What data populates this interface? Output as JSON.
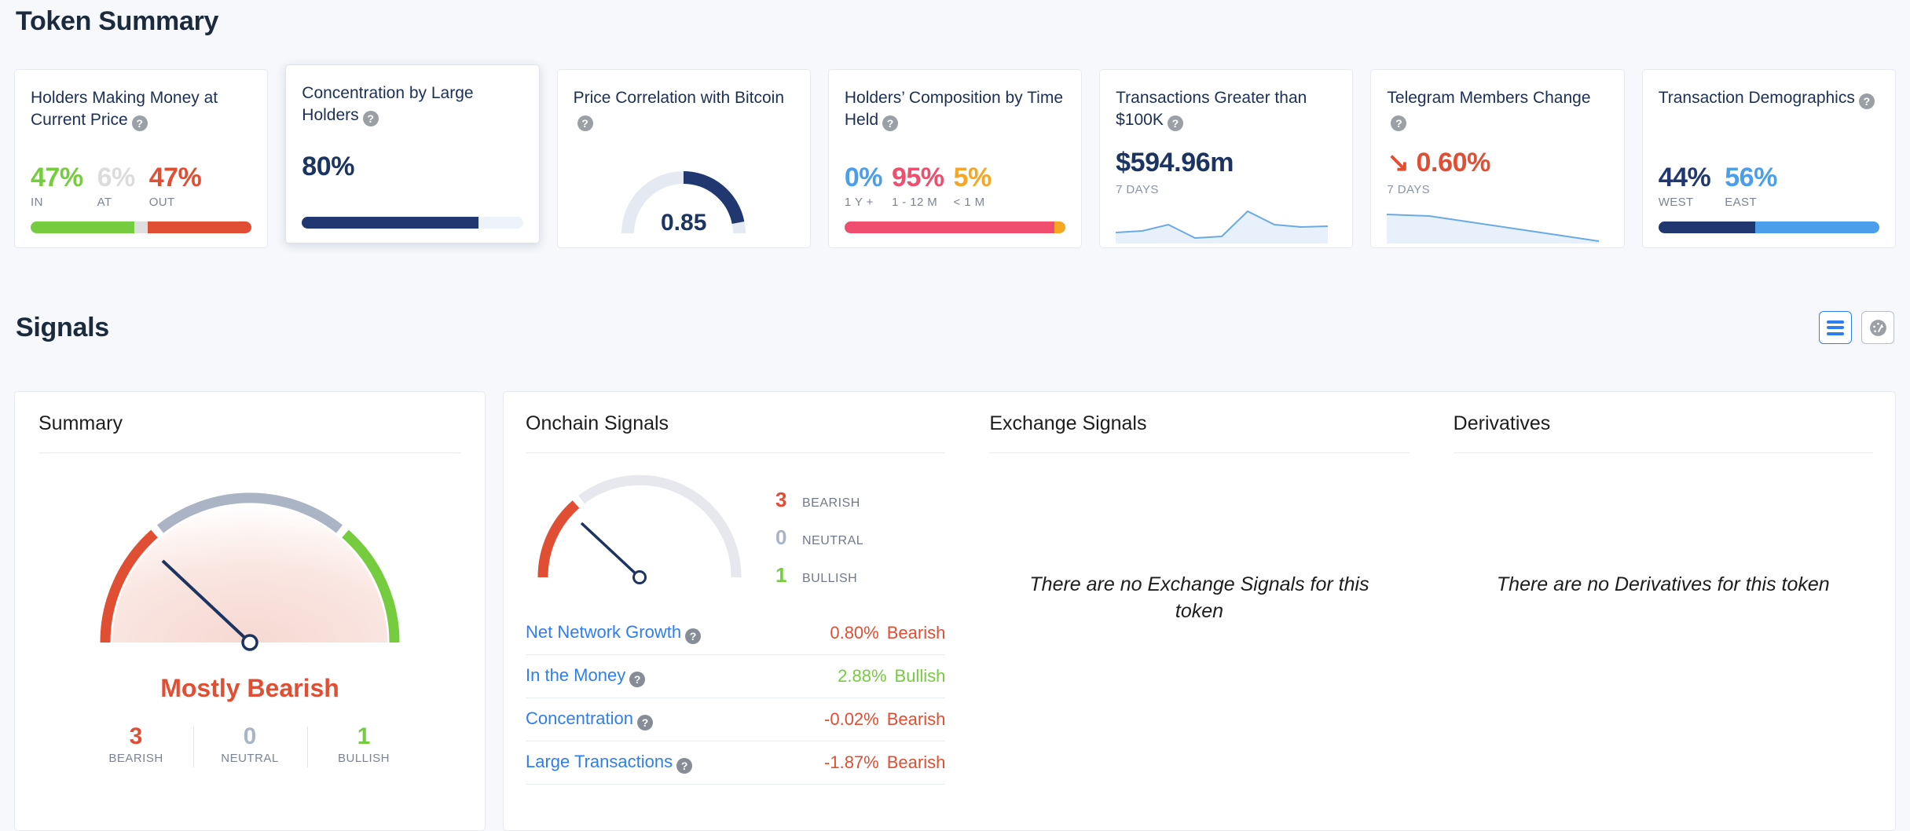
{
  "tokenSummary": {
    "title": "Token Summary",
    "cards": [
      {
        "title": "Holders Making Money at Current Price",
        "help": "?",
        "stats": [
          {
            "value": "47%",
            "label": "IN",
            "color": "#76cc3f"
          },
          {
            "value": "6%",
            "label": "AT",
            "color": "#dcdcdc"
          },
          {
            "value": "47%",
            "label": "OUT",
            "color": "#e04e33"
          }
        ],
        "bar": [
          {
            "pct": 47,
            "color": "#76cc3f"
          },
          {
            "pct": 6,
            "color": "#dedede"
          },
          {
            "pct": 47,
            "color": "#e04e33"
          }
        ]
      },
      {
        "title": "Concentration by Large Holders",
        "help": "?",
        "value": "80%",
        "bar": [
          {
            "pct": 80,
            "color": "#20386f"
          },
          {
            "pct": 20,
            "color": "#eef3fa"
          }
        ]
      },
      {
        "title": "Price Correlation with Bitcoin",
        "help": "?",
        "gauge": {
          "value": "0.85",
          "fraction": 0.85,
          "color": "#20386f",
          "track": "#e4e9f2"
        }
      },
      {
        "title": "Holders’ Composition by Time Held",
        "help": "?",
        "stats": [
          {
            "value": "0%",
            "label": "1 Y +",
            "color": "#4a9eea"
          },
          {
            "value": "95%",
            "label": "1 - 12 M",
            "color": "#ef4e6e"
          },
          {
            "value": "5%",
            "label": "< 1 M",
            "color": "#f5a623"
          }
        ],
        "bar": [
          {
            "pct": 0,
            "color": "#4a9eea"
          },
          {
            "pct": 95,
            "color": "#ef4e6e"
          },
          {
            "pct": 5,
            "color": "#f5a623"
          }
        ]
      },
      {
        "title": "Transactions Greater than $100K",
        "help": "?",
        "value": "$594.96m",
        "period": "7 DAYS",
        "sparkline": [
          28,
          30,
          44,
          14,
          18,
          78,
          46,
          40,
          41
        ]
      },
      {
        "title": "Telegram Members Change",
        "help": "?",
        "value": "0.60%",
        "arrow": "↘",
        "valueColor": "#e04e33",
        "period": "7 DAYS",
        "sparkline": [
          74,
          70,
          54,
          38,
          22,
          6
        ]
      },
      {
        "title": "Transaction Demographics",
        "help": "?",
        "stats": [
          {
            "value": "44%",
            "label": "WEST",
            "color": "#20386f"
          },
          {
            "value": "56%",
            "label": "EAST",
            "color": "#4a9eea"
          }
        ],
        "bar": [
          {
            "pct": 44,
            "color": "#20386f"
          },
          {
            "pct": 56,
            "color": "#4a9eea"
          }
        ]
      }
    ]
  },
  "signals": {
    "title": "Signals",
    "viewToggle": {
      "list": {
        "icon": "list-view-icon",
        "active": true
      },
      "gauge": {
        "icon": "gauge-view-icon",
        "active": false
      }
    },
    "summary": {
      "title": "Summary",
      "verdict": "Mostly Bearish",
      "verdictColor": "#e04e33",
      "needleFraction": 0.2,
      "counts": [
        {
          "n": "3",
          "label": "BEARISH",
          "color": "#e04e33"
        },
        {
          "n": "0",
          "label": "NEUTRAL",
          "color": "#aab4c4"
        },
        {
          "n": "1",
          "label": "BULLISH",
          "color": "#76cc3f"
        }
      ]
    },
    "onchain": {
      "title": "Onchain Signals",
      "needleFraction": 0.2,
      "legend": [
        {
          "n": "3",
          "label": "BEARISH",
          "color": "#e04e33"
        },
        {
          "n": "0",
          "label": "NEUTRAL",
          "color": "#aab4c4"
        },
        {
          "n": "1",
          "label": "BULLISH",
          "color": "#76cc3f"
        }
      ],
      "rows": [
        {
          "name": "Net Network Growth",
          "help": "?",
          "pct": "0.80%",
          "signal": "Bearish",
          "color": "#e04e33"
        },
        {
          "name": "In the Money",
          "help": "?",
          "pct": "2.88%",
          "signal": "Bullish",
          "color": "#76cc3f"
        },
        {
          "name": "Concentration",
          "help": "?",
          "pct": "-0.02%",
          "signal": "Bearish",
          "color": "#e04e33"
        },
        {
          "name": "Large Transactions",
          "help": "?",
          "pct": "-1.87%",
          "signal": "Bearish",
          "color": "#e04e33"
        }
      ]
    },
    "exchange": {
      "title": "Exchange Signals",
      "empty": "There are no Exchange Signals for this token"
    },
    "derivatives": {
      "title": "Derivatives",
      "empty": "There are no Derivatives for this token"
    }
  }
}
